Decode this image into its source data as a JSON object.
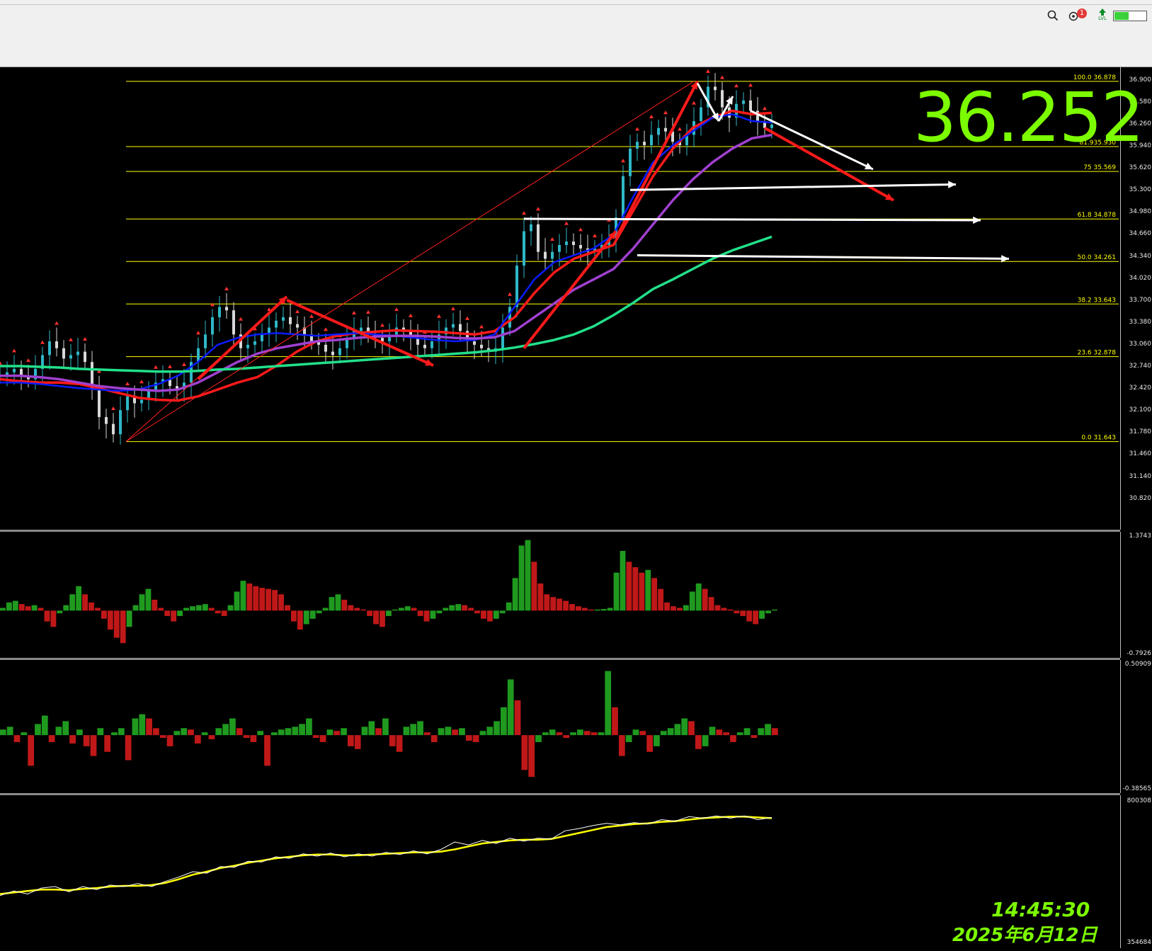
{
  "toolbar": {
    "icons": [
      "search-icon",
      "notification-icon",
      "level-icon",
      "battery-icon"
    ],
    "notification_count": "1",
    "level_label": "LVL",
    "battery_level": 0.45
  },
  "overlay": {
    "price": "36.252",
    "time": "14:45:30",
    "date": "2025年6月12日"
  },
  "colors": {
    "fib_line": "#ffff00",
    "ma_red": "#ff1a1a",
    "ma_blue": "#0a1cff",
    "ma_purple": "#a040d0",
    "ma_green": "#22e08a",
    "bull": "#1f9a1f",
    "bear": "#c01818",
    "arrow_white": "#ffffff",
    "price_overlay": "#7cfc00"
  },
  "chart_data": [
    {
      "type": "line",
      "panel": "price",
      "ylim": [
        30.6,
        37.0
      ],
      "yticks": [
        "36.900",
        "36.580",
        "36.260",
        "35.940",
        "35.620",
        "35.300",
        "34.980",
        "34.660",
        "34.340",
        "34.020",
        "33.700",
        "33.380",
        "33.060",
        "32.740",
        "32.420",
        "32.100",
        "31.780",
        "31.460",
        "31.140",
        "30.820"
      ],
      "fib_levels": [
        {
          "label": "100.0 36.878",
          "value": 36.878
        },
        {
          "label": "81.935.930",
          "value": 35.93
        },
        {
          "label": "75 35.569",
          "value": 35.569
        },
        {
          "label": "61.8 34.878",
          "value": 34.878
        },
        {
          "label": "50.0 34.261",
          "value": 34.261
        },
        {
          "label": "38.2 33.643",
          "value": 33.643
        },
        {
          "label": "23.6 32.878",
          "value": 32.878
        },
        {
          "label": "0.0 31.643",
          "value": 31.643
        }
      ],
      "close": [
        32.6,
        32.65,
        32.7,
        32.6,
        32.55,
        32.7,
        32.9,
        33.1,
        33.0,
        32.85,
        32.9,
        32.95,
        32.8,
        32.4,
        32.0,
        31.9,
        31.75,
        32.1,
        32.3,
        32.2,
        32.25,
        32.4,
        32.5,
        32.55,
        32.45,
        32.4,
        32.5,
        32.8,
        33.0,
        33.2,
        33.45,
        33.6,
        33.55,
        33.2,
        33.0,
        33.05,
        33.1,
        33.2,
        33.3,
        33.4,
        33.45,
        33.35,
        33.3,
        33.2,
        33.1,
        33.05,
        32.95,
        32.9,
        33.0,
        33.15,
        33.25,
        33.3,
        33.2,
        33.15,
        33.1,
        33.2,
        33.3,
        33.25,
        33.15,
        33.05,
        33.0,
        33.1,
        33.2,
        33.3,
        33.35,
        33.25,
        33.1,
        33.05,
        33.0,
        32.95,
        33.0,
        33.3,
        33.6,
        34.2,
        34.7,
        34.8,
        34.4,
        34.3,
        34.4,
        34.5,
        34.55,
        34.5,
        34.45,
        34.4,
        34.45,
        34.5,
        34.6,
        34.9,
        35.5,
        35.9,
        36.0,
        35.95,
        36.1,
        36.2,
        36.15,
        36.0,
        35.95,
        36.1,
        36.3,
        36.5,
        36.8,
        36.75,
        36.5,
        36.35,
        36.55,
        36.6,
        36.45,
        36.3,
        36.2,
        36.25
      ],
      "moving_averages": [
        {
          "color": "#ff1a1a",
          "values": [
            32.55,
            32.52,
            32.5,
            32.5,
            32.48,
            32.42,
            32.35,
            32.28,
            32.25,
            32.24,
            32.3,
            32.4,
            32.5,
            32.58,
            32.75,
            32.95,
            33.1,
            33.18,
            33.22,
            33.24,
            33.26,
            33.25,
            33.24,
            33.22,
            33.2,
            33.25,
            33.45,
            33.8,
            34.1,
            34.3,
            34.4,
            34.5,
            35.0,
            35.5,
            35.9,
            36.2,
            36.35,
            36.45,
            36.4,
            36.42
          ]
        },
        {
          "color": "#0a1cff",
          "values": [
            32.5,
            32.5,
            32.48,
            32.45,
            32.42,
            32.4,
            32.38,
            32.4,
            32.48,
            32.6,
            32.8,
            33.05,
            33.15,
            33.2,
            33.22,
            33.2,
            33.18,
            33.2,
            33.22,
            33.2,
            33.18,
            33.15,
            33.12,
            33.1,
            33.12,
            33.2,
            33.6,
            34.0,
            34.25,
            34.35,
            34.45,
            34.65,
            35.2,
            35.7,
            35.95,
            36.15,
            36.35,
            36.4,
            36.3,
            36.28
          ]
        },
        {
          "color": "#a040d0",
          "values": [
            32.6,
            32.6,
            32.58,
            32.55,
            32.5,
            32.45,
            32.42,
            32.4,
            32.38,
            32.4,
            32.5,
            32.65,
            32.8,
            32.92,
            33.0,
            33.05,
            33.1,
            33.12,
            33.15,
            33.17,
            33.18,
            33.18,
            33.17,
            33.15,
            33.14,
            33.16,
            33.25,
            33.45,
            33.65,
            33.85,
            34.0,
            34.15,
            34.45,
            34.8,
            35.15,
            35.45,
            35.7,
            35.9,
            36.05,
            36.1
          ]
        },
        {
          "color": "#22e08a",
          "values": [
            32.74,
            32.74,
            32.73,
            32.72,
            32.7,
            32.69,
            32.68,
            32.67,
            32.66,
            32.66,
            32.67,
            32.69,
            32.7,
            32.72,
            32.74,
            32.76,
            32.78,
            32.8,
            32.82,
            32.84,
            32.86,
            32.88,
            32.9,
            32.92,
            32.94,
            32.97,
            33.01,
            33.06,
            33.12,
            33.2,
            33.32,
            33.48,
            33.66,
            33.86,
            34.0,
            34.15,
            34.3,
            34.42,
            34.52,
            34.62
          ]
        }
      ]
    },
    {
      "type": "bar",
      "panel": "oscillator-1",
      "yticks": [
        "1.3743",
        "-0.7926"
      ],
      "ylim": [
        -0.7926,
        1.3743
      ],
      "values": [
        0.05,
        0.15,
        0.18,
        0.12,
        0.08,
        0.1,
        0.05,
        -0.2,
        -0.3,
        -0.05,
        0.1,
        0.3,
        0.45,
        0.3,
        0.15,
        0.05,
        -0.15,
        -0.35,
        -0.5,
        -0.6,
        -0.3,
        0.1,
        0.3,
        0.4,
        0.2,
        0.05,
        -0.1,
        -0.2,
        -0.1,
        0.05,
        0.08,
        0.1,
        0.12,
        0.05,
        -0.05,
        -0.1,
        0.1,
        0.35,
        0.55,
        0.5,
        0.45,
        0.42,
        0.4,
        0.38,
        0.3,
        0.1,
        -0.2,
        -0.35,
        -0.25,
        -0.15,
        -0.05,
        0.05,
        0.25,
        0.3,
        0.2,
        0.1,
        0.05,
        0.02,
        -0.1,
        -0.25,
        -0.3,
        -0.1,
        0.02,
        0.05,
        0.08,
        0.05,
        -0.1,
        -0.2,
        -0.15,
        -0.05,
        0.05,
        0.1,
        0.12,
        0.1,
        0.05,
        -0.05,
        -0.15,
        -0.2,
        -0.15,
        -0.05,
        0.15,
        0.6,
        1.2,
        1.3,
        0.9,
        0.5,
        0.3,
        0.25,
        0.22,
        0.18,
        0.12,
        0.08,
        0.05,
        0.02,
        0.02,
        0.03,
        0.05,
        0.7,
        1.1,
        0.9,
        0.8,
        0.7,
        0.75,
        0.6,
        0.4,
        0.15,
        0.08,
        0.05,
        0.1,
        0.35,
        0.5,
        0.4,
        0.25,
        0.1,
        0.05,
        0.02,
        -0.05,
        -0.1,
        -0.2,
        -0.25,
        -0.15,
        -0.05,
        0.02
      ]
    },
    {
      "type": "bar",
      "panel": "oscillator-2",
      "yticks": [
        "0.50909",
        "-0.38565"
      ],
      "ylim": [
        -0.38565,
        0.50909
      ],
      "values": [
        0.04,
        0.06,
        -0.05,
        0.02,
        -0.22,
        0.08,
        0.14,
        -0.05,
        0.06,
        0.1,
        -0.06,
        0.04,
        -0.08,
        -0.15,
        0.05,
        -0.12,
        0.02,
        0.05,
        -0.18,
        0.12,
        0.15,
        0.12,
        0.05,
        -0.02,
        -0.08,
        0.03,
        0.05,
        0.04,
        -0.06,
        0.02,
        -0.03,
        0.05,
        0.08,
        0.12,
        0.05,
        -0.02,
        -0.05,
        0.03,
        -0.22,
        0.02,
        0.04,
        0.05,
        0.06,
        0.08,
        0.12,
        -0.02,
        -0.05,
        0.04,
        0.03,
        0.05,
        -0.08,
        -0.1,
        0.06,
        0.1,
        0.05,
        0.12,
        -0.08,
        -0.12,
        0.06,
        0.08,
        0.1,
        0.02,
        -0.05,
        0.05,
        0.06,
        0.04,
        0.05,
        -0.04,
        -0.05,
        0.03,
        0.06,
        0.1,
        0.2,
        0.4,
        0.25,
        -0.25,
        -0.3,
        -0.05,
        0.02,
        0.04,
        0.02,
        -0.02,
        0.02,
        0.04,
        0.03,
        0.02,
        0.02,
        0.46,
        0.2,
        -0.15,
        -0.05,
        0.04,
        0.03,
        -0.12,
        -0.08,
        0.03,
        0.05,
        0.08,
        0.12,
        0.1,
        -0.1,
        -0.08,
        0.06,
        0.04,
        0.02,
        -0.05,
        0.02,
        0.05,
        -0.02,
        0.05,
        0.08,
        0.05
      ],
      "markers": []
    },
    {
      "type": "line",
      "panel": "volume-accumulation",
      "yticks": [
        "800308",
        "354684"
      ],
      "ylim": [
        354684,
        800308
      ],
      "series": [
        {
          "color": "#ffff00",
          "values": [
            0.1,
            0.12,
            0.14,
            0.16,
            0.16,
            0.15,
            0.17,
            0.18,
            0.2,
            0.21,
            0.21,
            0.22,
            0.25,
            0.3,
            0.36,
            0.4,
            0.45,
            0.48,
            0.52,
            0.55,
            0.58,
            0.6,
            0.62,
            0.63,
            0.63,
            0.62,
            0.62,
            0.63,
            0.64,
            0.65,
            0.66,
            0.66,
            0.67,
            0.7,
            0.74,
            0.78,
            0.8,
            0.82,
            0.83,
            0.83,
            0.84,
            0.88,
            0.92,
            0.96,
            1.0,
            1.02,
            1.04,
            1.05,
            1.07,
            1.08,
            1.1,
            1.12,
            1.13,
            1.14,
            1.14,
            1.13,
            1.12
          ]
        },
        {
          "color": "#ffffff",
          "values": [
            0.08,
            0.14,
            0.1,
            0.18,
            0.2,
            0.13,
            0.2,
            0.16,
            0.22,
            0.2,
            0.24,
            0.2,
            0.27,
            0.33,
            0.4,
            0.38,
            0.47,
            0.46,
            0.54,
            0.53,
            0.6,
            0.58,
            0.64,
            0.61,
            0.65,
            0.6,
            0.64,
            0.61,
            0.66,
            0.63,
            0.68,
            0.64,
            0.7,
            0.8,
            0.76,
            0.82,
            0.78,
            0.85,
            0.81,
            0.85,
            0.84,
            0.95,
            0.98,
            1.02,
            1.05,
            1.03,
            1.06,
            1.04,
            1.1,
            1.08,
            1.14,
            1.12,
            1.15,
            1.12,
            1.15,
            1.1,
            1.13
          ]
        }
      ]
    }
  ]
}
